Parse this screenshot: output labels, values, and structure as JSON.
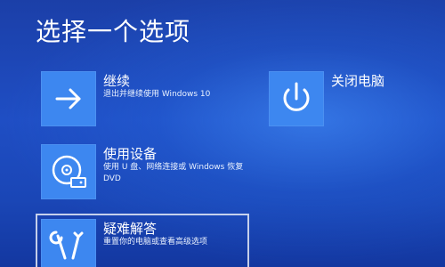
{
  "page_title": "选择一个选项",
  "options": {
    "continue": {
      "label": "继续",
      "description": "退出并继续使用 Windows 10",
      "icon": "arrow-right-icon"
    },
    "use_device": {
      "label": "使用设备",
      "description": "使用 U 盘、网络连接或 Windows 恢复 DVD",
      "icon": "disc-drive-icon"
    },
    "troubleshoot": {
      "label": "疑难解答",
      "description": "重置你的电脑或查看高级选项",
      "icon": "tools-icon"
    },
    "shutdown": {
      "label": "关闭电脑",
      "icon": "power-icon"
    }
  },
  "colors": {
    "background": "#1f4ec4",
    "tile": "#3d87f0",
    "text": "#ffffff"
  }
}
